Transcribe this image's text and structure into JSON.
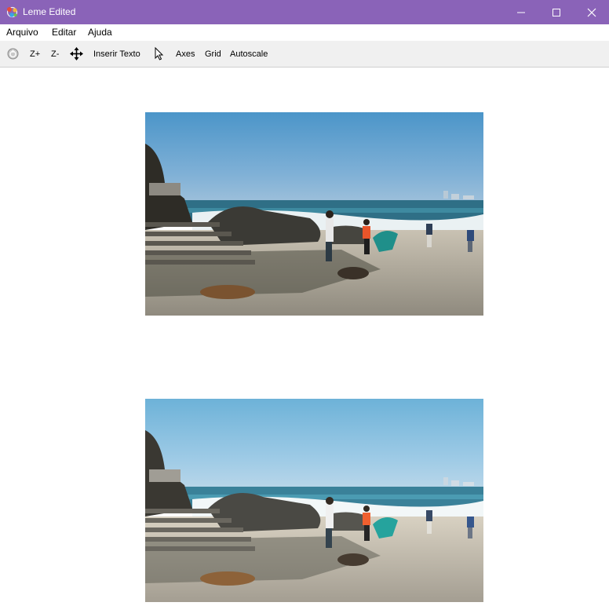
{
  "window": {
    "title": "Leme Edited",
    "icon": "app-logo-icon",
    "controls": [
      "minimize-icon",
      "maximize-icon",
      "close-icon"
    ],
    "title_bar_color": "#8a63b8"
  },
  "menu": {
    "items": [
      {
        "label": "Arquivo"
      },
      {
        "label": "Editar"
      },
      {
        "label": "Ajuda"
      }
    ]
  },
  "toolbar": {
    "reset_icon": "reset-view-icon",
    "zoom_in_label": "Z+",
    "zoom_out_label": "Z-",
    "pan_icon": "move-arrows-icon",
    "insert_text_label": "Inserir Texto",
    "pointer_icon": "cursor-pointer-icon",
    "axes_label": "Axes",
    "grid_label": "Grid",
    "autoscale_label": "Autoscale"
  },
  "content": {
    "images": [
      {
        "description_icon": "beach-photo-original"
      },
      {
        "description_icon": "beach-photo-edited"
      }
    ]
  }
}
